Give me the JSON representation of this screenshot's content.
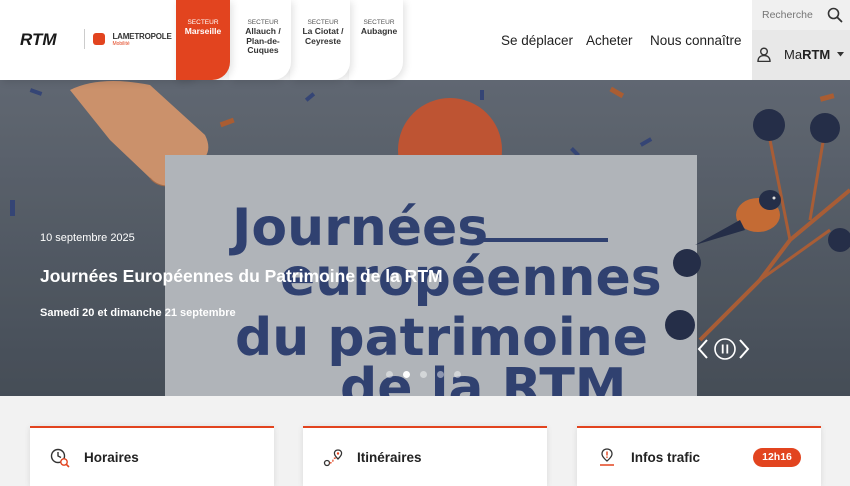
{
  "brand": {
    "rtm_logo": "RTM",
    "metropole_name": "LAMETROPOLE",
    "metropole_sub": "Mobilité"
  },
  "sectors": [
    {
      "label": "Secteur",
      "name": "Marseille",
      "active": true
    },
    {
      "label": "Secteur",
      "name": "Allauch / Plan-de-Cuques",
      "active": false
    },
    {
      "label": "Secteur",
      "name": "La Ciotat / Ceyreste",
      "active": false
    },
    {
      "label": "Secteur",
      "name": "Aubagne",
      "active": false
    }
  ],
  "nav": {
    "items": [
      "Se déplacer",
      "Acheter",
      "Nous connaître"
    ]
  },
  "search": {
    "placeholder": "Recherche",
    "icon": "search-icon"
  },
  "account": {
    "prefix": "Ma",
    "name": "RTM",
    "icon": "user-icon"
  },
  "hero": {
    "date": "10 septembre 2025",
    "title": "Journées Européennes du Patrimoine de la RTM",
    "subtitle": "Samedi 20 et dimanche 21 septembre",
    "poster_lines": [
      "Journées",
      "européennes",
      "du patrimoine",
      "de la RTM"
    ],
    "slides_count": 5,
    "active_slide": 2
  },
  "cards": [
    {
      "title": "Horaires",
      "icon": "clock-search-icon"
    },
    {
      "title": "Itinéraires",
      "icon": "route-icon"
    },
    {
      "title": "Infos trafic",
      "icon": "traffic-pin-icon",
      "badge": "12h16"
    }
  ],
  "colors": {
    "accent": "#e2441f",
    "poster_blue": "#2b3f7a",
    "header_bg": "#ffffff"
  }
}
